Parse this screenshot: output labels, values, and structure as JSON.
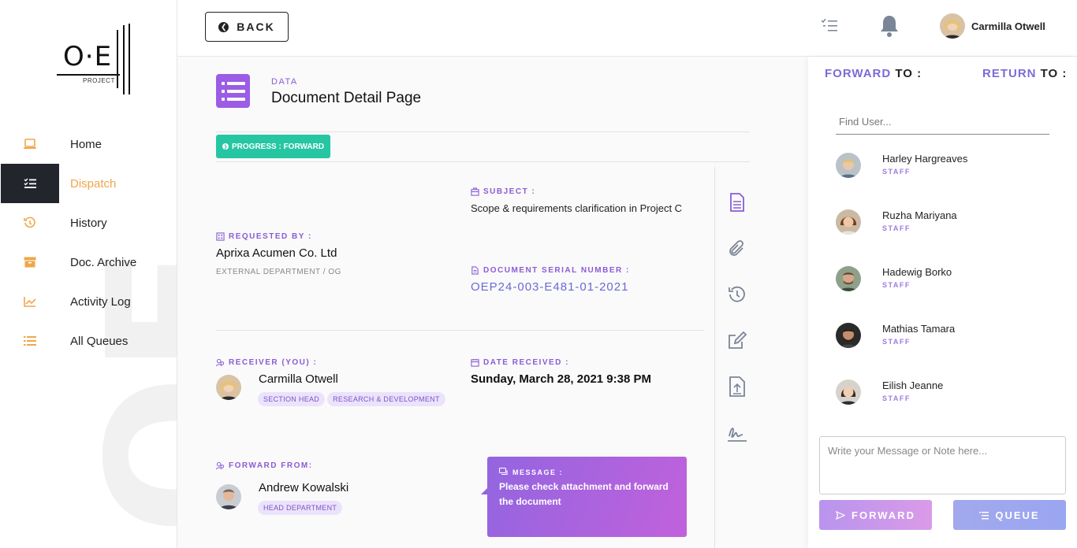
{
  "logo": {
    "text": "O·E",
    "sub": "PROJECT"
  },
  "watermark": "OE",
  "nav": {
    "items": [
      {
        "label": "Home",
        "icon": "laptop-icon",
        "active": false
      },
      {
        "label": "Dispatch",
        "icon": "list-check-icon",
        "active": true
      },
      {
        "label": "History",
        "icon": "history-icon",
        "active": false
      },
      {
        "label": "Doc. Archive",
        "icon": "archive-icon",
        "active": false
      },
      {
        "label": "Activity Log",
        "icon": "chart-line-icon",
        "active": false
      },
      {
        "label": "All Queues",
        "icon": "list-icon",
        "active": false
      }
    ]
  },
  "topbar": {
    "back_label": "BACK",
    "user_name": "Carmilla Otwell"
  },
  "header": {
    "kicker": "DATA",
    "title": "Document Detail Page"
  },
  "progress": {
    "label": "PROGRESS : FORWARD"
  },
  "document": {
    "requested_by_label": "REQUESTED BY :",
    "requested_by": "Aprixa Acumen Co. Ltd",
    "requested_by_sub": "EXTERNAL DEPARTMENT / OG",
    "subject_label": "SUBJECT :",
    "subject": "Scope & requirements clarification in Project C",
    "serial_label": "DOCUMENT SERIAL NUMBER :",
    "serial": "OEP24-003-E481-01-2021",
    "receiver_label": "RECEIVER (YOU) :",
    "receiver_name": "Carmilla Otwell",
    "receiver_tags": [
      "SECTION HEAD",
      "RESEARCH & DEVELOPMENT"
    ],
    "date_label": "DATE RECEIVED :",
    "date": "Sunday, March 28, 2021 9:38 PM",
    "forward_from_label": "FORWARD FROM:",
    "forward_from_name": "Andrew Kowalski",
    "forward_from_tags": [
      "HEAD DEPARTMENT"
    ],
    "message_label": "MESSAGE :",
    "message": "Please check attachment and forward the document"
  },
  "tools": [
    "document-icon",
    "paperclip-icon",
    "history-icon",
    "edit-icon",
    "upload-file-icon",
    "signature-icon"
  ],
  "right_panel": {
    "forward_hl": "FORWARD",
    "forward_rest": " TO :",
    "return_hl": "RETURN",
    "return_rest": " TO :",
    "search_placeholder": "Find User...",
    "users": [
      {
        "name": "Harley Hargreaves",
        "role": "STAFF"
      },
      {
        "name": "Ruzha Mariyana",
        "role": "STAFF"
      },
      {
        "name": "Hadewig Borko",
        "role": "STAFF"
      },
      {
        "name": "Mathias Tamara",
        "role": "STAFF"
      },
      {
        "name": "Eilish Jeanne",
        "role": "STAFF"
      }
    ],
    "note_placeholder": "Write your Message or Note here...",
    "forward_button": "FORWARD",
    "queue_button": "QUEUE"
  },
  "colors": {
    "accent_orange": "#f0a64a",
    "accent_purple": "#8a5cd6",
    "progress_green": "#26c6a2",
    "sidebar_active_bg": "#22262c"
  }
}
